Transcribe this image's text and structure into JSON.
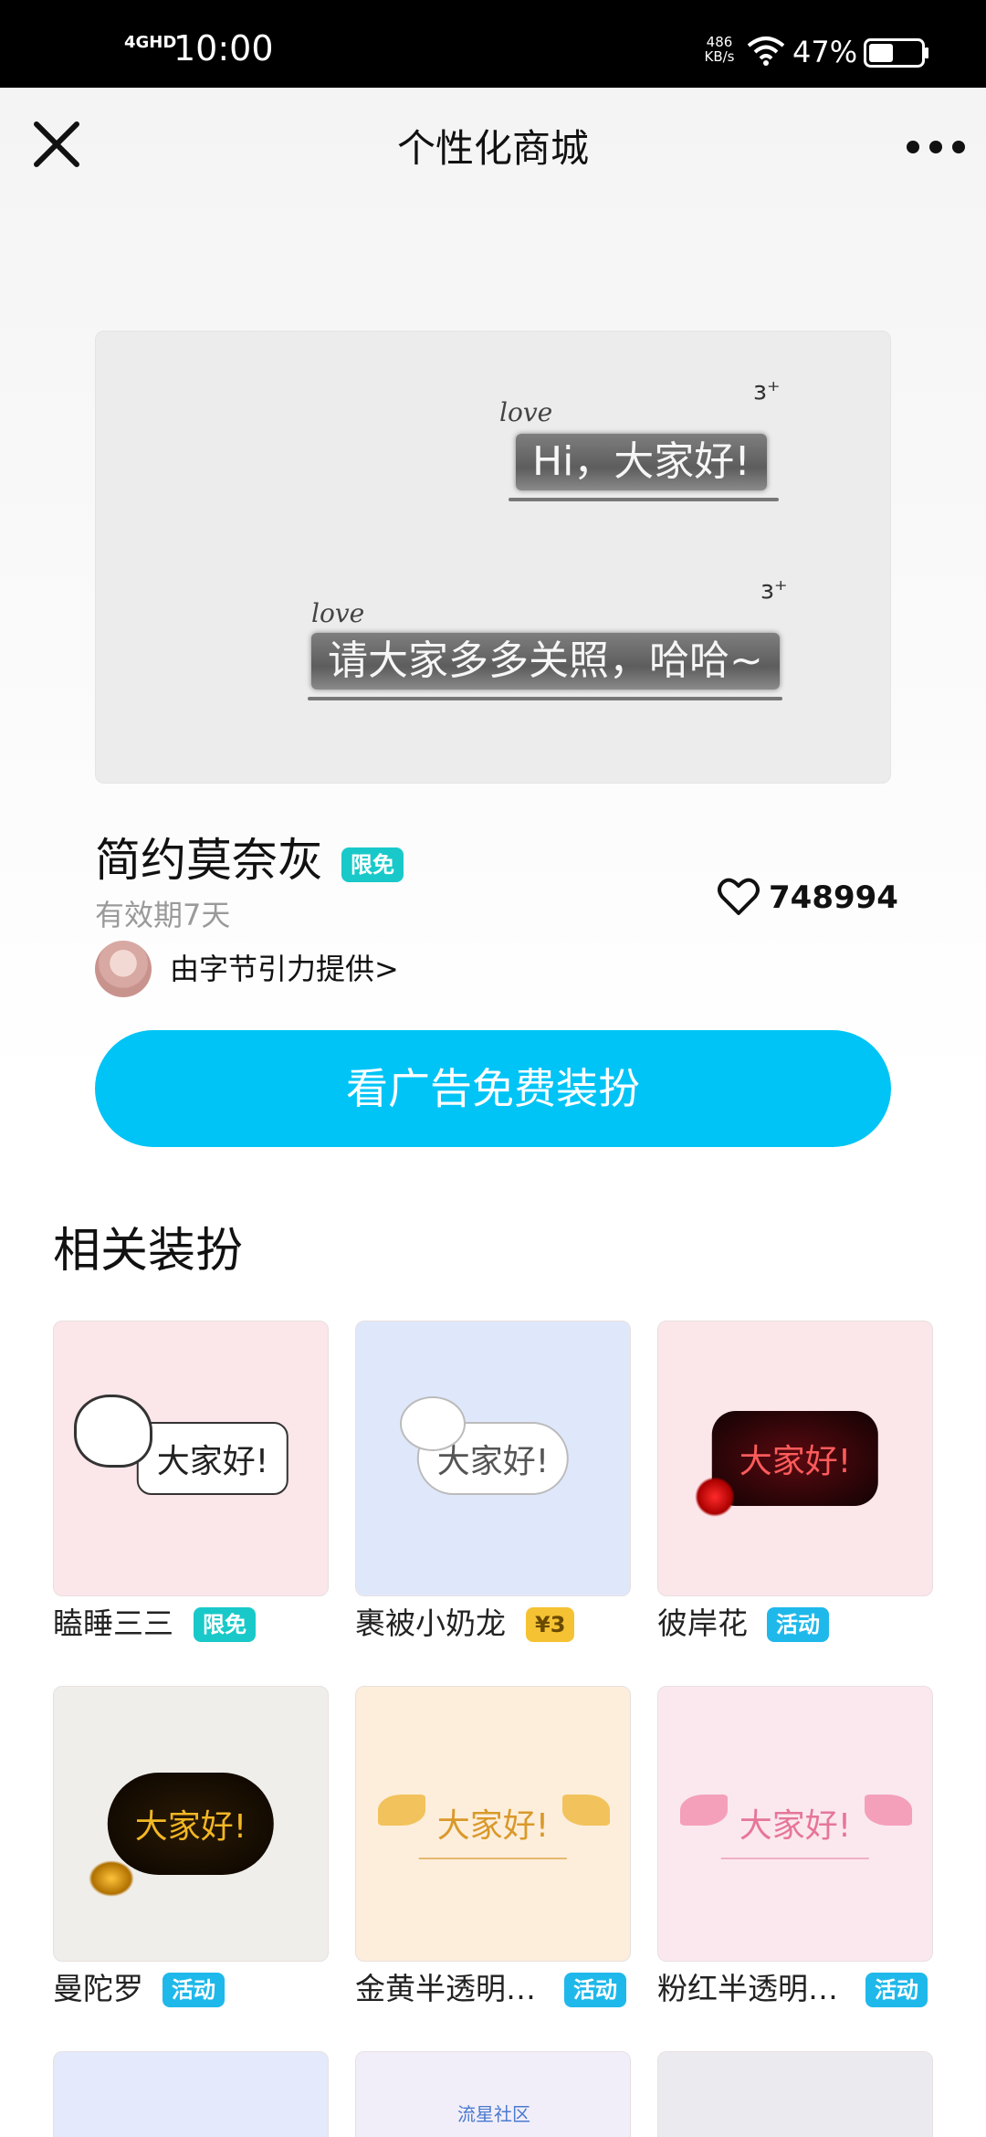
{
  "status_bar": {
    "network": "4GHD",
    "time": "10:00",
    "speed_value": "486",
    "speed_unit": "KB/s",
    "battery_percent": "47%",
    "battery_level": 0.47
  },
  "header": {
    "title": "个性化商城",
    "close_icon": "close-icon",
    "more_icon": "more-icon"
  },
  "preview": {
    "love_text": "love",
    "bubble_1": "Hi，大家好!",
    "bubble_2": "请大家多多关照，哈哈~"
  },
  "item": {
    "name": "简约莫奈灰",
    "tag": "限免",
    "validity": "有效期7天",
    "likes": "748994",
    "provider": "由字节引力提供>"
  },
  "cta_label": "看广告免费装扮",
  "section_title": "相关装扮",
  "related": [
    {
      "label": "瞌睡三三",
      "tag": "限免",
      "tag_type": "free",
      "bubble": "大家好!"
    },
    {
      "label": "裹被小奶龙",
      "tag": "¥3",
      "tag_type": "price",
      "bubble": "大家好!"
    },
    {
      "label": "彼岸花",
      "tag": "活动",
      "tag_type": "event",
      "bubble": "大家好!"
    },
    {
      "label": "曼陀罗",
      "tag": "活动",
      "tag_type": "event",
      "bubble": "大家好!"
    },
    {
      "label": "金黄半透明…",
      "tag": "活动",
      "tag_type": "event",
      "bubble": "大家好!"
    },
    {
      "label": "粉红半透明…",
      "tag": "活动",
      "tag_type": "event",
      "bubble": "大家好!"
    },
    {
      "partial_text": "流星社区"
    }
  ],
  "colors": {
    "accent": "#00c4f6",
    "tag_free": "#19c9c9",
    "tag_price": "#f5c233",
    "tag_event": "#1fb8ea"
  }
}
